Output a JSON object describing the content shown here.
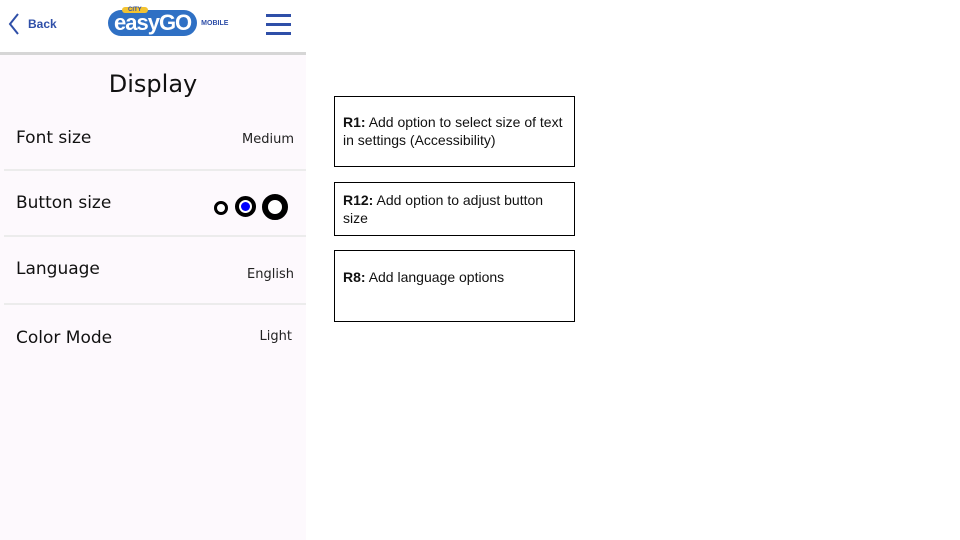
{
  "header": {
    "back_label": "Back",
    "logo_city": "CITY",
    "logo_text": "easyGO",
    "logo_sub": "MOBILE"
  },
  "page_title": "Display",
  "settings": [
    {
      "label": "Font size",
      "value": "Medium"
    },
    {
      "label": "Button size",
      "selected_index": 1,
      "options": [
        "small",
        "medium",
        "large"
      ]
    },
    {
      "label": "Language",
      "value": "English"
    },
    {
      "label": "Color Mode",
      "value": "Light"
    }
  ],
  "notes": [
    {
      "id": "R1:",
      "text": "Add option to select size of text in settings (Accessibility)"
    },
    {
      "id": "R12:",
      "text": "Add option to adjust button size"
    },
    {
      "id": "R8:",
      "text": "Add language options"
    }
  ],
  "colors": {
    "accent": "#2f4fa8",
    "selected": "#0000ff"
  }
}
